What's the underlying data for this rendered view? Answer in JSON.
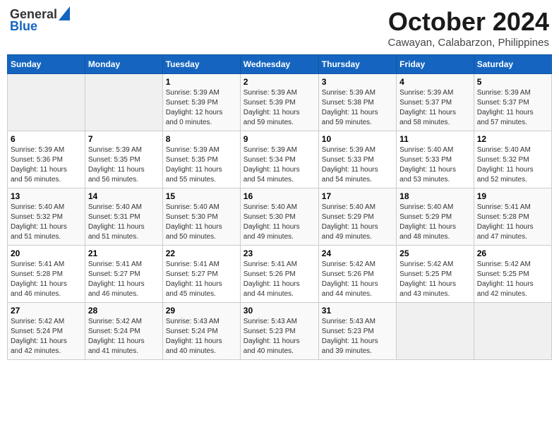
{
  "header": {
    "logo_general": "General",
    "logo_blue": "Blue",
    "title": "October 2024",
    "subtitle": "Cawayan, Calabarzon, Philippines"
  },
  "calendar": {
    "days_of_week": [
      "Sunday",
      "Monday",
      "Tuesday",
      "Wednesday",
      "Thursday",
      "Friday",
      "Saturday"
    ],
    "weeks": [
      [
        {
          "day": "",
          "info": ""
        },
        {
          "day": "",
          "info": ""
        },
        {
          "day": "1",
          "info": "Sunrise: 5:39 AM\nSunset: 5:39 PM\nDaylight: 12 hours\nand 0 minutes."
        },
        {
          "day": "2",
          "info": "Sunrise: 5:39 AM\nSunset: 5:39 PM\nDaylight: 11 hours\nand 59 minutes."
        },
        {
          "day": "3",
          "info": "Sunrise: 5:39 AM\nSunset: 5:38 PM\nDaylight: 11 hours\nand 59 minutes."
        },
        {
          "day": "4",
          "info": "Sunrise: 5:39 AM\nSunset: 5:37 PM\nDaylight: 11 hours\nand 58 minutes."
        },
        {
          "day": "5",
          "info": "Sunrise: 5:39 AM\nSunset: 5:37 PM\nDaylight: 11 hours\nand 57 minutes."
        }
      ],
      [
        {
          "day": "6",
          "info": "Sunrise: 5:39 AM\nSunset: 5:36 PM\nDaylight: 11 hours\nand 56 minutes."
        },
        {
          "day": "7",
          "info": "Sunrise: 5:39 AM\nSunset: 5:35 PM\nDaylight: 11 hours\nand 56 minutes."
        },
        {
          "day": "8",
          "info": "Sunrise: 5:39 AM\nSunset: 5:35 PM\nDaylight: 11 hours\nand 55 minutes."
        },
        {
          "day": "9",
          "info": "Sunrise: 5:39 AM\nSunset: 5:34 PM\nDaylight: 11 hours\nand 54 minutes."
        },
        {
          "day": "10",
          "info": "Sunrise: 5:39 AM\nSunset: 5:33 PM\nDaylight: 11 hours\nand 54 minutes."
        },
        {
          "day": "11",
          "info": "Sunrise: 5:40 AM\nSunset: 5:33 PM\nDaylight: 11 hours\nand 53 minutes."
        },
        {
          "day": "12",
          "info": "Sunrise: 5:40 AM\nSunset: 5:32 PM\nDaylight: 11 hours\nand 52 minutes."
        }
      ],
      [
        {
          "day": "13",
          "info": "Sunrise: 5:40 AM\nSunset: 5:32 PM\nDaylight: 11 hours\nand 51 minutes."
        },
        {
          "day": "14",
          "info": "Sunrise: 5:40 AM\nSunset: 5:31 PM\nDaylight: 11 hours\nand 51 minutes."
        },
        {
          "day": "15",
          "info": "Sunrise: 5:40 AM\nSunset: 5:30 PM\nDaylight: 11 hours\nand 50 minutes."
        },
        {
          "day": "16",
          "info": "Sunrise: 5:40 AM\nSunset: 5:30 PM\nDaylight: 11 hours\nand 49 minutes."
        },
        {
          "day": "17",
          "info": "Sunrise: 5:40 AM\nSunset: 5:29 PM\nDaylight: 11 hours\nand 49 minutes."
        },
        {
          "day": "18",
          "info": "Sunrise: 5:40 AM\nSunset: 5:29 PM\nDaylight: 11 hours\nand 48 minutes."
        },
        {
          "day": "19",
          "info": "Sunrise: 5:41 AM\nSunset: 5:28 PM\nDaylight: 11 hours\nand 47 minutes."
        }
      ],
      [
        {
          "day": "20",
          "info": "Sunrise: 5:41 AM\nSunset: 5:28 PM\nDaylight: 11 hours\nand 46 minutes."
        },
        {
          "day": "21",
          "info": "Sunrise: 5:41 AM\nSunset: 5:27 PM\nDaylight: 11 hours\nand 46 minutes."
        },
        {
          "day": "22",
          "info": "Sunrise: 5:41 AM\nSunset: 5:27 PM\nDaylight: 11 hours\nand 45 minutes."
        },
        {
          "day": "23",
          "info": "Sunrise: 5:41 AM\nSunset: 5:26 PM\nDaylight: 11 hours\nand 44 minutes."
        },
        {
          "day": "24",
          "info": "Sunrise: 5:42 AM\nSunset: 5:26 PM\nDaylight: 11 hours\nand 44 minutes."
        },
        {
          "day": "25",
          "info": "Sunrise: 5:42 AM\nSunset: 5:25 PM\nDaylight: 11 hours\nand 43 minutes."
        },
        {
          "day": "26",
          "info": "Sunrise: 5:42 AM\nSunset: 5:25 PM\nDaylight: 11 hours\nand 42 minutes."
        }
      ],
      [
        {
          "day": "27",
          "info": "Sunrise: 5:42 AM\nSunset: 5:24 PM\nDaylight: 11 hours\nand 42 minutes."
        },
        {
          "day": "28",
          "info": "Sunrise: 5:42 AM\nSunset: 5:24 PM\nDaylight: 11 hours\nand 41 minutes."
        },
        {
          "day": "29",
          "info": "Sunrise: 5:43 AM\nSunset: 5:24 PM\nDaylight: 11 hours\nand 40 minutes."
        },
        {
          "day": "30",
          "info": "Sunrise: 5:43 AM\nSunset: 5:23 PM\nDaylight: 11 hours\nand 40 minutes."
        },
        {
          "day": "31",
          "info": "Sunrise: 5:43 AM\nSunset: 5:23 PM\nDaylight: 11 hours\nand 39 minutes."
        },
        {
          "day": "",
          "info": ""
        },
        {
          "day": "",
          "info": ""
        }
      ]
    ]
  }
}
